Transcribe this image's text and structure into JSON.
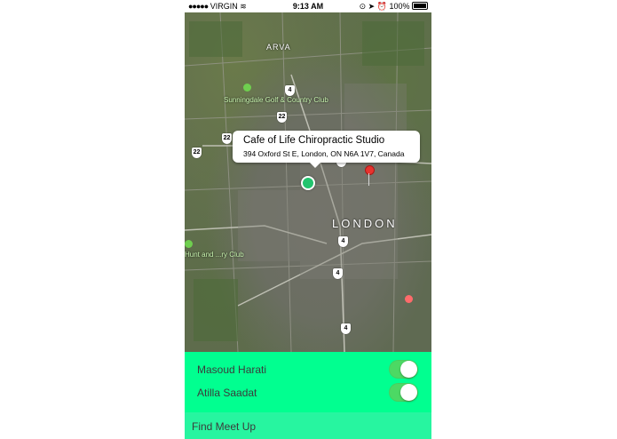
{
  "status_bar": {
    "carrier": "VIRGIN",
    "time": "9:13 AM",
    "battery": "100%"
  },
  "map": {
    "labels": {
      "arva": "ARVA",
      "london": "LONDON",
      "golf_club": "Sunningdale Golf & Country Club",
      "golf_club_2": "Hunt and ...ry Club"
    },
    "highway_shields": [
      "4",
      "22",
      "22",
      "22",
      "4",
      "4",
      "4",
      "4"
    ],
    "callout": {
      "title": "Cafe of Life Chiropractic Studio",
      "address": "394 Oxford St E, London, ON N6A 1V7, Canada"
    }
  },
  "people": [
    {
      "name": "Masoud Harati",
      "enabled": true
    },
    {
      "name": "Atilla Saadat",
      "enabled": true
    }
  ],
  "actions": {
    "find_meetup": "Find Meet Up"
  },
  "colors": {
    "panel": "#01ff90",
    "find_bar": "#27f5a0",
    "toggle_on": "#4cd964",
    "user_dot": "#22c46e",
    "pin": "#e8332e"
  }
}
